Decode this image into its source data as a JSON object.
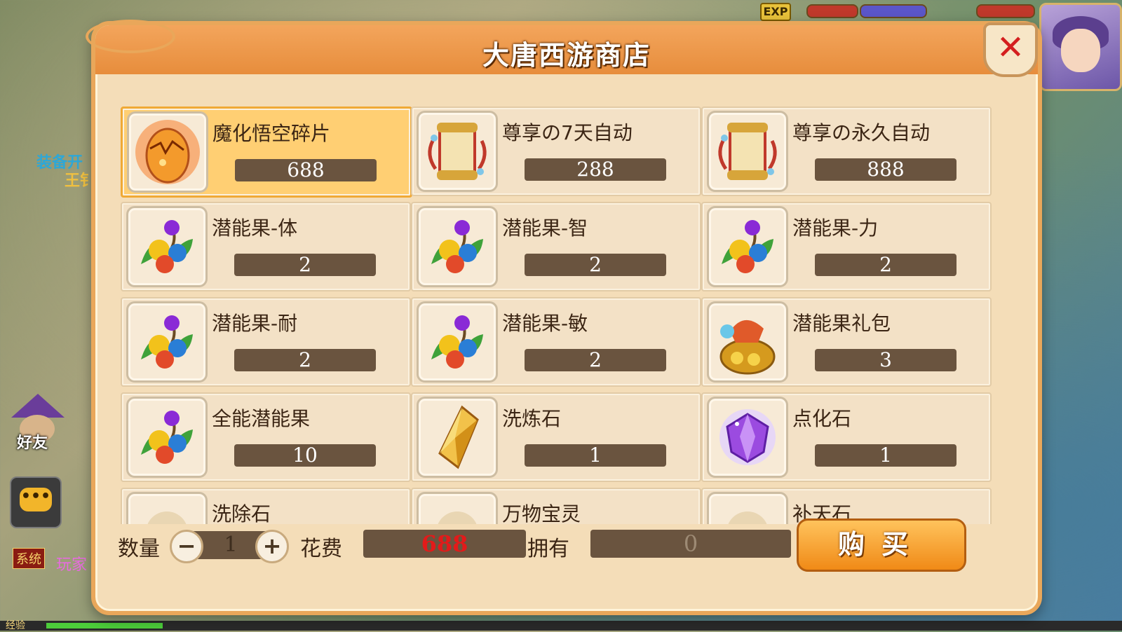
{
  "hud": {
    "exp_label": "EXP",
    "friend_label": "好友",
    "chat_label": "•••",
    "system_tag": "系统",
    "player_text": "玩家",
    "equip_text": "装备开",
    "king_text": "王钅",
    "xp_label": "经验"
  },
  "shop": {
    "title": "大唐西游商店",
    "close_label": "✕",
    "items": [
      {
        "name": "魔化悟空碎片",
        "price": "688",
        "icon": "cracked-egg-icon",
        "selected": true
      },
      {
        "name": "尊享の7天自动",
        "price": "288",
        "icon": "scroll-icon"
      },
      {
        "name": "尊享の永久自动",
        "price": "888",
        "icon": "scroll-icon"
      },
      {
        "name": "潜能果-体",
        "price": "2",
        "icon": "potential-fruit-icon"
      },
      {
        "name": "潜能果-智",
        "price": "2",
        "icon": "potential-fruit-icon"
      },
      {
        "name": "潜能果-力",
        "price": "2",
        "icon": "potential-fruit-icon"
      },
      {
        "name": "潜能果-耐",
        "price": "2",
        "icon": "potential-fruit-icon"
      },
      {
        "name": "潜能果-敏",
        "price": "2",
        "icon": "potential-fruit-icon"
      },
      {
        "name": "潜能果礼包",
        "price": "3",
        "icon": "gift-bag-icon"
      },
      {
        "name": "全能潜能果",
        "price": "10",
        "icon": "potential-fruit-icon"
      },
      {
        "name": "洗炼石",
        "price": "1",
        "icon": "gold-crystal-icon"
      },
      {
        "name": "点化石",
        "price": "1",
        "icon": "purple-gem-icon"
      },
      {
        "name": "洗除石",
        "price": "",
        "icon": "partial-item-icon"
      },
      {
        "name": "万物宝灵",
        "price": "",
        "icon": "partial-item-icon"
      },
      {
        "name": "补天石",
        "price": "",
        "icon": "partial-item-icon"
      }
    ],
    "footer": {
      "quantity_label": "数量",
      "quantity_value": "1",
      "minus_label": "−",
      "plus_label": "+",
      "cost_label": "花费",
      "cost_value": "688",
      "own_label": "拥有",
      "own_value": "0",
      "buy_label": "购买"
    }
  }
}
